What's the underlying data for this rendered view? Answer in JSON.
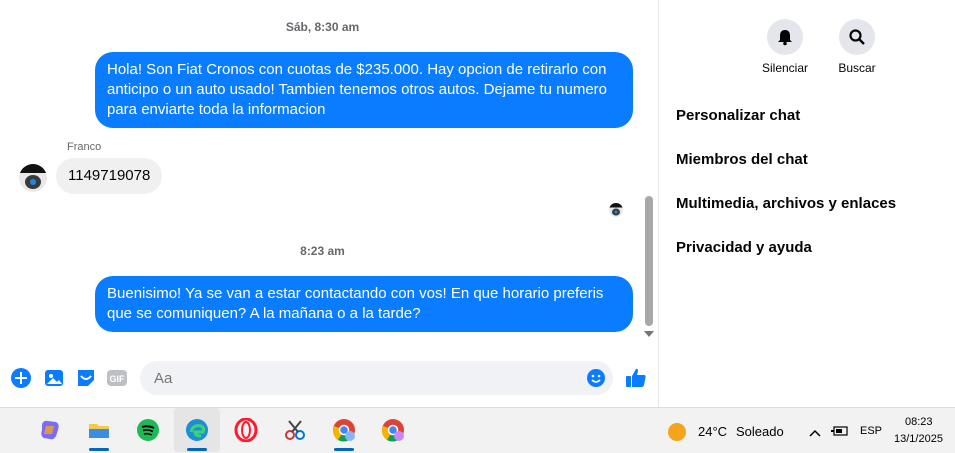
{
  "chat": {
    "timestamp_1": "Sáb, 8:30 am",
    "msg_out_1": "Hola! Son Fiat Cronos con cuotas de $235.000. Hay opcion de retirarlo con anticipo o un auto usado! Tambien tenemos otros autos. Dejame tu numero para enviarte toda la informacion",
    "sender_name": "Franco",
    "msg_in_1": "1149719078",
    "timestamp_2": "8:23 am",
    "msg_out_2": "Buenisimo! Ya se van a estar contactando con vos! En que horario preferis que se comuniquen? A la mañana o a la tarde?",
    "composer_placeholder": "Aa",
    "accent_color": "#0a7cff"
  },
  "panel": {
    "mute_label": "Silenciar",
    "search_label": "Buscar",
    "menu": [
      "Personalizar chat",
      "Miembros del chat",
      "Multimedia, archivos y enlaces",
      "Privacidad y ayuda"
    ]
  },
  "taskbar": {
    "weather_temp": "24°C",
    "weather_desc": "Soleado",
    "language": "ESP",
    "time": "08:23",
    "date": "13/1/2025"
  }
}
